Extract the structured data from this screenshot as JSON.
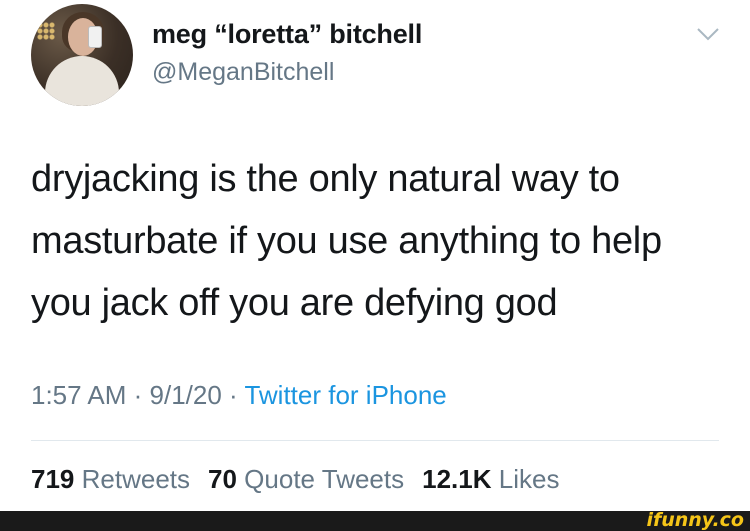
{
  "user": {
    "display_name": "meg “loretta” bitchell",
    "handle": "@MeganBitchell"
  },
  "tweet": {
    "lines": [
      "dryjacking is the only natural way to",
      "masturbate if you use anything to help",
      "you jack off you are defying god"
    ]
  },
  "meta": {
    "time": "1:57 AM",
    "separator": " · ",
    "date": "9/1/20",
    "source": "Twitter for iPhone"
  },
  "stats": {
    "retweets_count": "719",
    "retweets_label": "Retweets",
    "quotes_count": "70",
    "quotes_label": "Quote Tweets",
    "likes_count": "12.1K",
    "likes_label": "Likes"
  },
  "footer": {
    "brand": "ifunny.co"
  },
  "icons": {
    "menu": "chevron-down-icon"
  },
  "colors": {
    "text": "#14171a",
    "secondary": "#657786",
    "link": "#1b95e0",
    "brand": "#f5c518"
  }
}
